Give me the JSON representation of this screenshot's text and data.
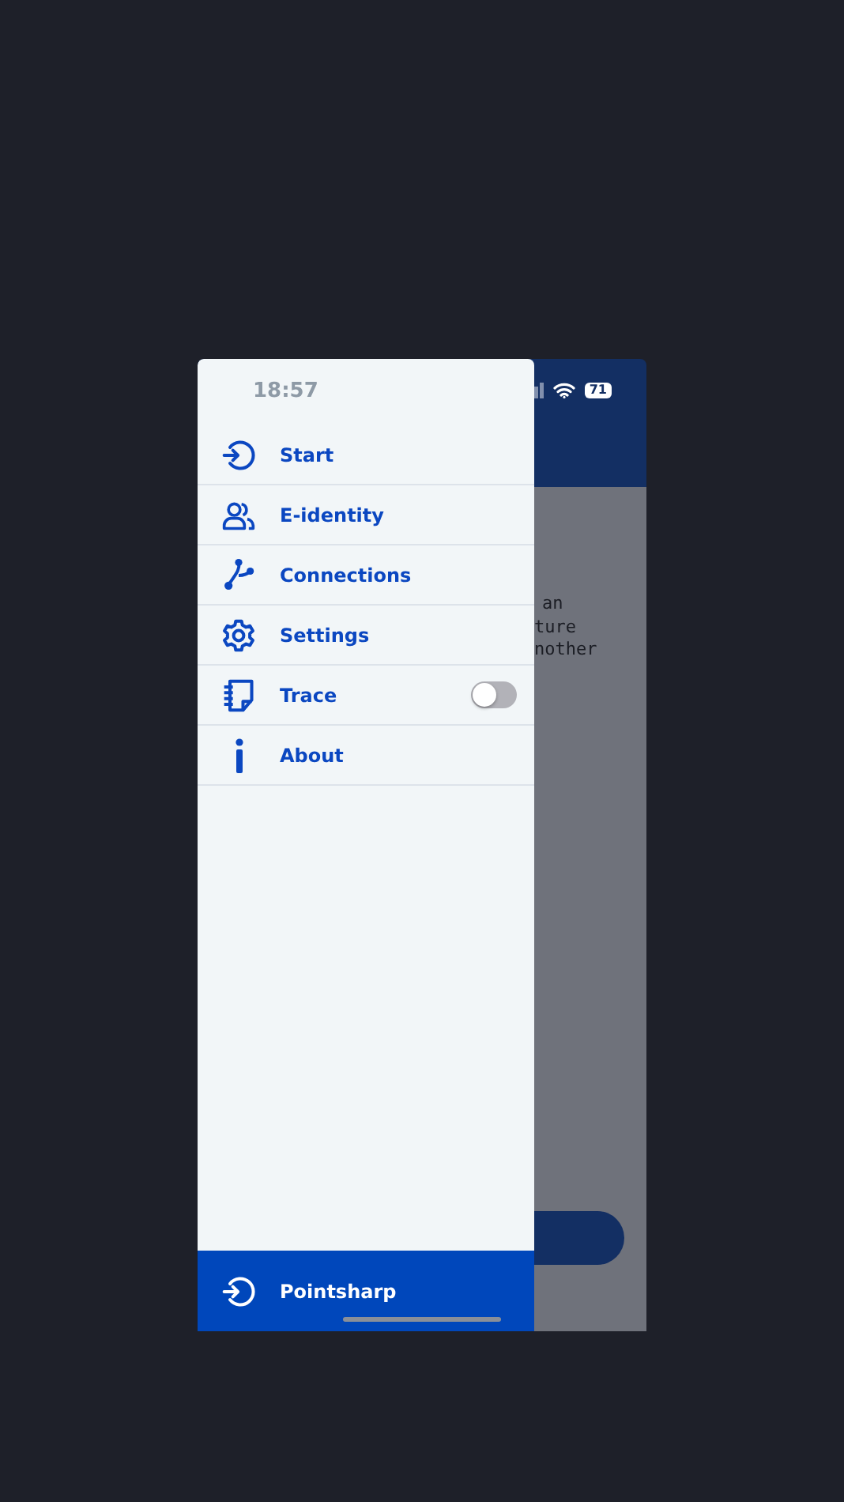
{
  "status_bar": {
    "time": "18:57",
    "battery": "71"
  },
  "background_page": {
    "text_lines": [
      "an",
      "ture",
      "nother"
    ]
  },
  "menu": {
    "items": [
      {
        "label": "Start",
        "kind": "link"
      },
      {
        "label": "E-identity",
        "kind": "link"
      },
      {
        "label": "Connections",
        "kind": "link"
      },
      {
        "label": "Settings",
        "kind": "link"
      },
      {
        "label": "Trace",
        "kind": "toggle",
        "on": false
      },
      {
        "label": "About",
        "kind": "link"
      }
    ]
  },
  "footer": {
    "label": "Pointsharp"
  }
}
